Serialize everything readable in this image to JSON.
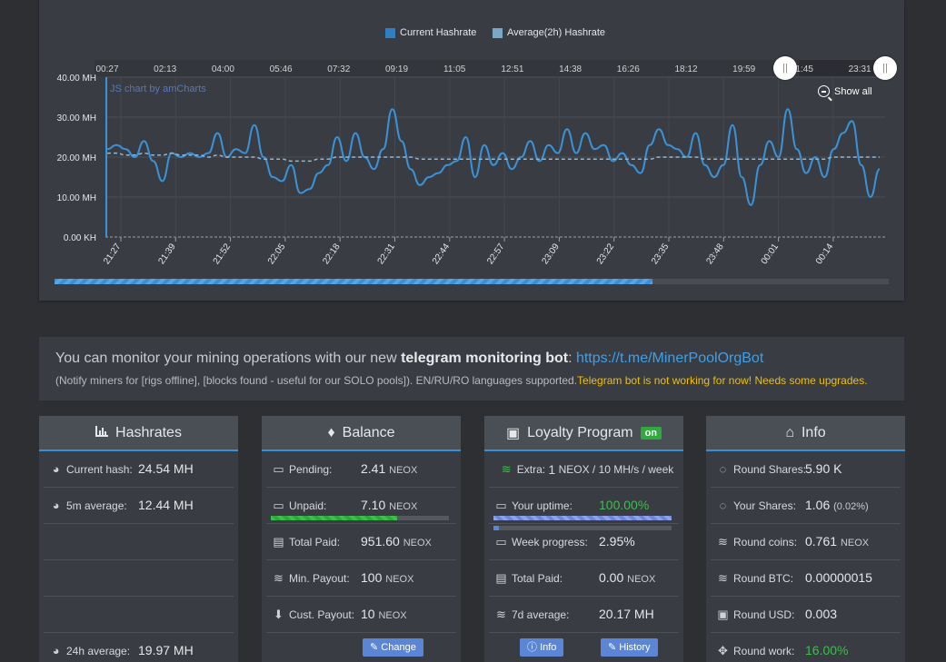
{
  "chart": {
    "legend": [
      {
        "label": "Current Hashrate",
        "color": "#2f7fc1"
      },
      {
        "label": "Average(2h) Hashrate",
        "color": "#7aa7c7"
      }
    ],
    "watermark": "JS chart by amCharts",
    "show_all": "Show all",
    "scrollbar_labels": [
      "00:27",
      "02:13",
      "04:00",
      "05:46",
      "07:32",
      "09:19",
      "11:05",
      "12:51",
      "14:38",
      "16:26",
      "18:12",
      "19:59",
      "21:45",
      "23:31"
    ],
    "handle_glyph": "||"
  },
  "chart_data": {
    "type": "line",
    "ylim": [
      0,
      40
    ],
    "y_ticks": [
      "0.00 KH",
      "10.00 MH",
      "20.00 MH",
      "30.00 MH",
      "40.00 MH"
    ],
    "x_ticks": [
      "21:27",
      "21:39",
      "21:52",
      "22:05",
      "22:18",
      "22:31",
      "22:44",
      "22:57",
      "23:09",
      "23:22",
      "23:35",
      "23:48",
      "00:01",
      "00:14"
    ],
    "series": [
      {
        "name": "Current Hashrate",
        "color": "#3a93d8",
        "values": [
          22,
          23,
          22,
          20,
          24,
          19,
          14,
          21,
          20,
          21,
          20,
          21,
          26,
          20,
          22,
          21,
          28,
          20,
          15,
          14,
          18,
          11,
          12,
          16,
          18,
          25,
          19,
          26,
          20,
          17,
          22,
          32,
          24,
          17,
          13,
          15,
          16,
          18,
          19,
          25,
          15,
          23,
          18,
          21,
          17,
          20,
          24,
          19,
          23,
          21,
          27,
          21,
          26,
          22,
          23,
          19,
          21,
          18,
          16,
          23,
          27,
          23,
          22,
          20,
          26,
          18,
          15,
          18,
          28,
          15,
          8,
          18,
          24,
          20,
          32,
          22,
          16,
          20,
          15,
          22,
          26,
          29,
          18,
          10,
          17
        ]
      },
      {
        "name": "Average(2h) Hashrate",
        "color": "#8fb6d2",
        "values": [
          21,
          21,
          20.5,
          20.5,
          21,
          20.5,
          20.5,
          21,
          20.5,
          20.5,
          20.5,
          20,
          20.5,
          20,
          20,
          20,
          20,
          19.5,
          19.5,
          19.5,
          19,
          19,
          19,
          19.5,
          19.5,
          20,
          20,
          20,
          20,
          20,
          20,
          20,
          20,
          20,
          19.5,
          19.5,
          19.5,
          19.5,
          19.5,
          19.5,
          19.5,
          19.5,
          19.5,
          19.5,
          19.5,
          19.5,
          19.5,
          19.5,
          19.5,
          19.5,
          19.5,
          19.5,
          19.5,
          19.5,
          19.5,
          19.5,
          19.5,
          19.5,
          19.5,
          19.5,
          20,
          20,
          20,
          20,
          20,
          19.5,
          19.5,
          19.5,
          19.5,
          19.5,
          19.5,
          19.5,
          19.5,
          19.5,
          19.5,
          19.5,
          19.5,
          19.5,
          19.5,
          20,
          20,
          20,
          20,
          20,
          20
        ]
      }
    ]
  },
  "notice": {
    "line1_prefix": "You can monitor your mining operations with our new ",
    "line1_bold": "telegram monitoring bot",
    "line1_colon": ": ",
    "line1_link": "https://t.me/MinerPoolOrgBot",
    "line2": "(Notify miners for [rigs offline], [blocks found - useful for our SOLO pools]). EN/RU/RO languages supported.",
    "line2_warn": "Telegram bot is not working for now! Needs some upgrades."
  },
  "hashrates": {
    "title": "Hashrates",
    "rows": [
      {
        "label": "Current hash:",
        "value": "24.54 MH"
      },
      {
        "label": "5m average:",
        "value": "12.44 MH"
      },
      {
        "label": "24h average:",
        "value": "19.97 MH"
      }
    ]
  },
  "balance": {
    "title": "Balance",
    "rows": [
      {
        "label": "Pending:",
        "value": "2.41",
        "unit": "NEOX"
      },
      {
        "label": "Unpaid:",
        "value": "7.10",
        "unit": "NEOX"
      },
      {
        "label": "Total Paid:",
        "value": "951.60",
        "unit": "NEOX"
      },
      {
        "label": "Min. Payout:",
        "value": "100",
        "unit": "NEOX"
      },
      {
        "label": "Cust. Payout:",
        "value": "10",
        "unit": "NEOX"
      }
    ],
    "unpaid_progress": 0.71,
    "change_button": "Change"
  },
  "loyalty": {
    "title": "Loyalty Program",
    "badge": "on",
    "extra_label": "Extra:",
    "extra_value": "1",
    "extra_unit": "NEOX / 10 MH/s / week",
    "rows": [
      {
        "label": "Your uptime:",
        "value": "100.00%"
      },
      {
        "label": "Week progress:",
        "value": "2.95%"
      },
      {
        "label": "Total Paid:",
        "value": "0.00",
        "unit": "NEOX"
      },
      {
        "label": "7d average:",
        "value": "20.17 MH"
      }
    ],
    "uptime_progress": 1.0,
    "week_progress": 0.0295,
    "info_button": "Info",
    "history_button": "History"
  },
  "info": {
    "title": "Info",
    "rows": [
      {
        "label": "Round Shares:",
        "value": "5.90 K"
      },
      {
        "label": "Your Shares:",
        "value": "1.06",
        "sub": "(0.02%)"
      },
      {
        "label": "Round coins:",
        "value": "0.761",
        "unit": "NEOX"
      },
      {
        "label": "Round BTC:",
        "value": "0.00000015"
      },
      {
        "label": "Round USD:",
        "value": "0.003"
      },
      {
        "label": "Round work:",
        "value": "16.00%"
      }
    ]
  }
}
